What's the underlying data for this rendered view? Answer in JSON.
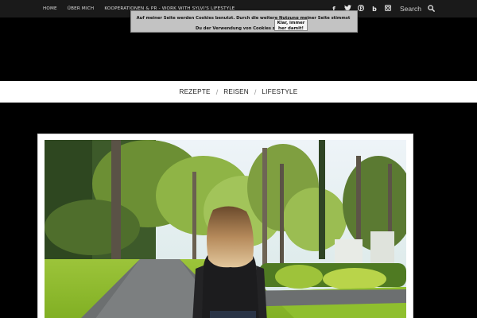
{
  "topbar": {
    "nav": [
      "HOME",
      "ÜBER MICH",
      "KOOPERATIONEN & PR - WORK WITH SYLVI'S LIFESTYLE"
    ],
    "social_icons": [
      {
        "name": "facebook-icon",
        "glyph": "f"
      },
      {
        "name": "twitter-icon",
        "glyph": "t"
      },
      {
        "name": "pinterest-icon",
        "glyph": "p"
      },
      {
        "name": "bloglovin-icon",
        "glyph": "b"
      },
      {
        "name": "instagram-icon",
        "glyph": "◘"
      }
    ],
    "search_label": "Search"
  },
  "cookie_banner": {
    "text": "Auf meiner Seite werden Cookies benutzt. Durch die weitere Nutzung meiner Seite stimmst Du der Verwendung von Cookies zu. Hm?",
    "button_label": "Klar, immer her damit!"
  },
  "main_nav": {
    "items": [
      "REZEPTE",
      "REISEN",
      "LIFESTYLE"
    ],
    "separator": "/"
  },
  "colors": {
    "background": "#000000",
    "topbar": "#1a1a1a",
    "cookie_banner": "#c3c3c3",
    "nav_bar": "#ffffff",
    "frame_border": "#d6d6d6"
  },
  "featured_image": {
    "icon": "photo-woman-walking-park-path"
  }
}
